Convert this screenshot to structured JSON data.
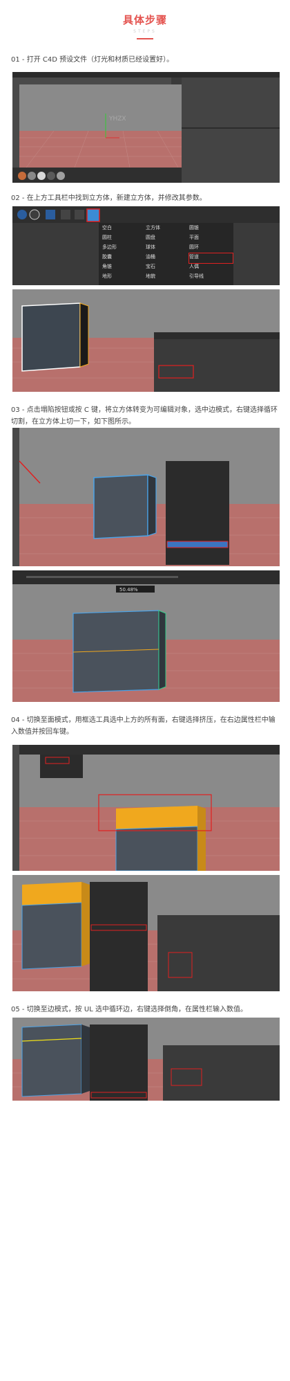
{
  "header": {
    "title": "具体步骤",
    "subtitle": "STEPS"
  },
  "steps": [
    {
      "text": "01 - 打开 C4D 预设文件（灯光和材质已经设置好）。"
    },
    {
      "text": "02 - 在上方工具栏中找到立方体，新建立方体，并修改其参数。"
    },
    {
      "text": "03 - 点击塌陷按钮或按 C 键，将立方体转变为可编辑对象，选中边模式，右键选择循环切割，在立方体上切一下，如下图所示。"
    },
    {
      "text": "04 - 切换至面模式，用框选工具选中上方的所有面，右键选择挤压，在右边属性栏中输入数值并按回车键。"
    },
    {
      "text": "05 - 切换至边模式，按 UL 选中循环边，右键选择倒角，在属性栏输入数值。"
    }
  ],
  "menu": {
    "items": [
      "空白",
      "立方体",
      "圆锥",
      "圆柱",
      "圆盘",
      "平面",
      "多边形",
      "球体",
      "圆环",
      "胶囊",
      "油桶",
      "管道",
      "角锥",
      "宝石",
      "人偶",
      "地形",
      "地貌",
      "引导线"
    ]
  },
  "slider": {
    "value_label": "50.48%"
  },
  "watermark": "YHZX",
  "colors": {
    "accent": "#e4534f",
    "floor": "#b8706c",
    "viewport_bg": "#8a8a8a",
    "panel": "#3a3a3a",
    "highlight": "#f0a81e",
    "select": "#e02020"
  }
}
